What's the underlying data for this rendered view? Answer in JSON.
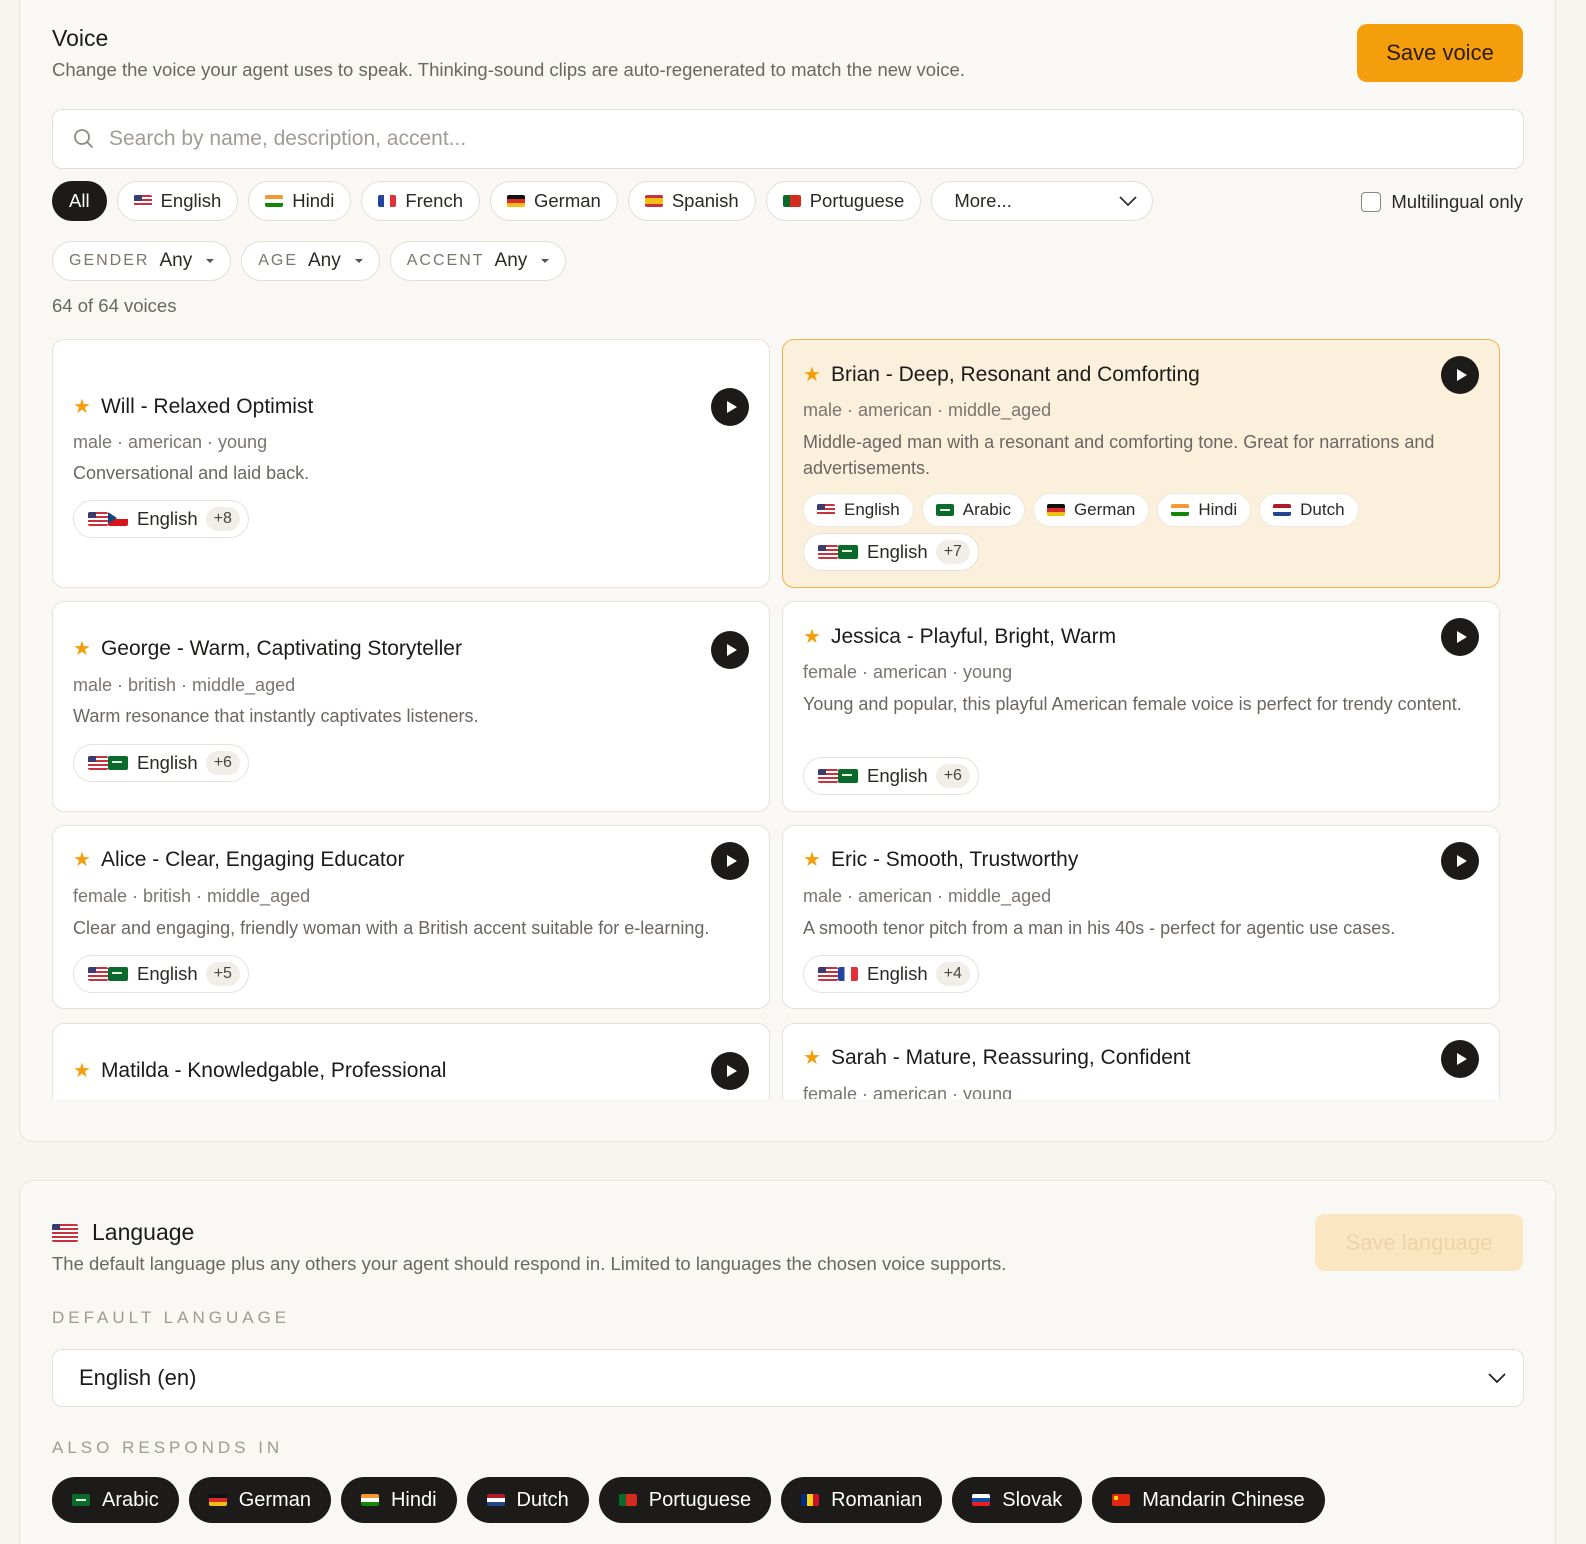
{
  "voice": {
    "title": "Voice",
    "subtitle": "Change the voice your agent uses to speak. Thinking-sound clips are auto-regenerated to match the new voice.",
    "save_label": "Save voice",
    "search_placeholder": "Search by name, description, accent...",
    "language_chips": [
      {
        "label": "All",
        "flag": "",
        "active": true
      },
      {
        "label": "English",
        "flag": "us"
      },
      {
        "label": "Hindi",
        "flag": "in"
      },
      {
        "label": "French",
        "flag": "fr"
      },
      {
        "label": "German",
        "flag": "de"
      },
      {
        "label": "Spanish",
        "flag": "es"
      },
      {
        "label": "Portuguese",
        "flag": "pt"
      }
    ],
    "more_label": "More...",
    "multilingual_label": "Multilingual only",
    "multilingual_checked": false,
    "filters": [
      {
        "key": "GENDER",
        "value": "Any"
      },
      {
        "key": "AGE",
        "value": "Any"
      },
      {
        "key": "ACCENT",
        "value": "Any"
      }
    ],
    "count_text": "64 of 64 voices",
    "cards": [
      {
        "name": "Will - Relaxed Optimist",
        "meta": "male · american · young",
        "desc": "Conversational and laid back.",
        "lang": "English",
        "more": "+8",
        "flags": [
          "us",
          "cz"
        ]
      },
      {
        "name": "Brian - Deep, Resonant and Comforting",
        "meta": "male · american · middle_aged",
        "desc": "Middle-aged man with a resonant and comforting tone. Great for narrations and advertisements.",
        "lang": "English",
        "more": "+7",
        "flags": [
          "us",
          "sa"
        ],
        "selected": true,
        "languages": [
          {
            "label": "English",
            "flag": "us"
          },
          {
            "label": "Arabic",
            "flag": "sa"
          },
          {
            "label": "German",
            "flag": "de"
          },
          {
            "label": "Hindi",
            "flag": "in"
          },
          {
            "label": "Dutch",
            "flag": "nl"
          }
        ]
      },
      {
        "name": "George - Warm, Captivating Storyteller",
        "meta": "male · british · middle_aged",
        "desc": "Warm resonance that instantly captivates listeners.",
        "lang": "English",
        "more": "+6",
        "flags": [
          "us",
          "sa"
        ]
      },
      {
        "name": "Jessica - Playful, Bright, Warm",
        "meta": "female · american · young",
        "desc": "Young and popular, this playful American female voice is perfect for trendy content.",
        "lang": "English",
        "more": "+6",
        "flags": [
          "us",
          "sa"
        ]
      },
      {
        "name": "Alice - Clear, Engaging Educator",
        "meta": "female · british · middle_aged",
        "desc": "Clear and engaging, friendly woman with a British accent suitable for e-learning.",
        "lang": "English",
        "more": "+5",
        "flags": [
          "us",
          "sa"
        ]
      },
      {
        "name": "Eric - Smooth, Trustworthy",
        "meta": "male · american · middle_aged",
        "desc": "A smooth tenor pitch from a man in his 40s - perfect for agentic use cases.",
        "lang": "English",
        "more": "+4",
        "flags": [
          "us",
          "fr"
        ]
      },
      {
        "name": "Matilda - Knowledgable, Professional",
        "meta": "",
        "desc": ""
      },
      {
        "name": "Sarah - Mature, Reassuring, Confident",
        "meta": "female · american · young",
        "desc": ""
      }
    ]
  },
  "language": {
    "title": "Language",
    "flag": "us",
    "subtitle": "The default language plus any others your agent should respond in. Limited to languages the chosen voice supports.",
    "save_label": "Save language",
    "default_label": "DEFAULT LANGUAGE",
    "default_value": "English (en)",
    "also_label": "ALSO RESPONDS IN",
    "also": [
      {
        "label": "Arabic",
        "flag": "sa"
      },
      {
        "label": "German",
        "flag": "de"
      },
      {
        "label": "Hindi",
        "flag": "in"
      },
      {
        "label": "Dutch",
        "flag": "nl"
      },
      {
        "label": "Portuguese",
        "flag": "pt"
      },
      {
        "label": "Romanian",
        "flag": "ro"
      },
      {
        "label": "Slovak",
        "flag": "sk"
      },
      {
        "label": "Mandarin Chinese",
        "flag": "cn"
      }
    ]
  },
  "colors": {
    "accent": "#f59e0b",
    "selected_card": "#fbf0dc",
    "dark_tag": "#1c1b19"
  }
}
